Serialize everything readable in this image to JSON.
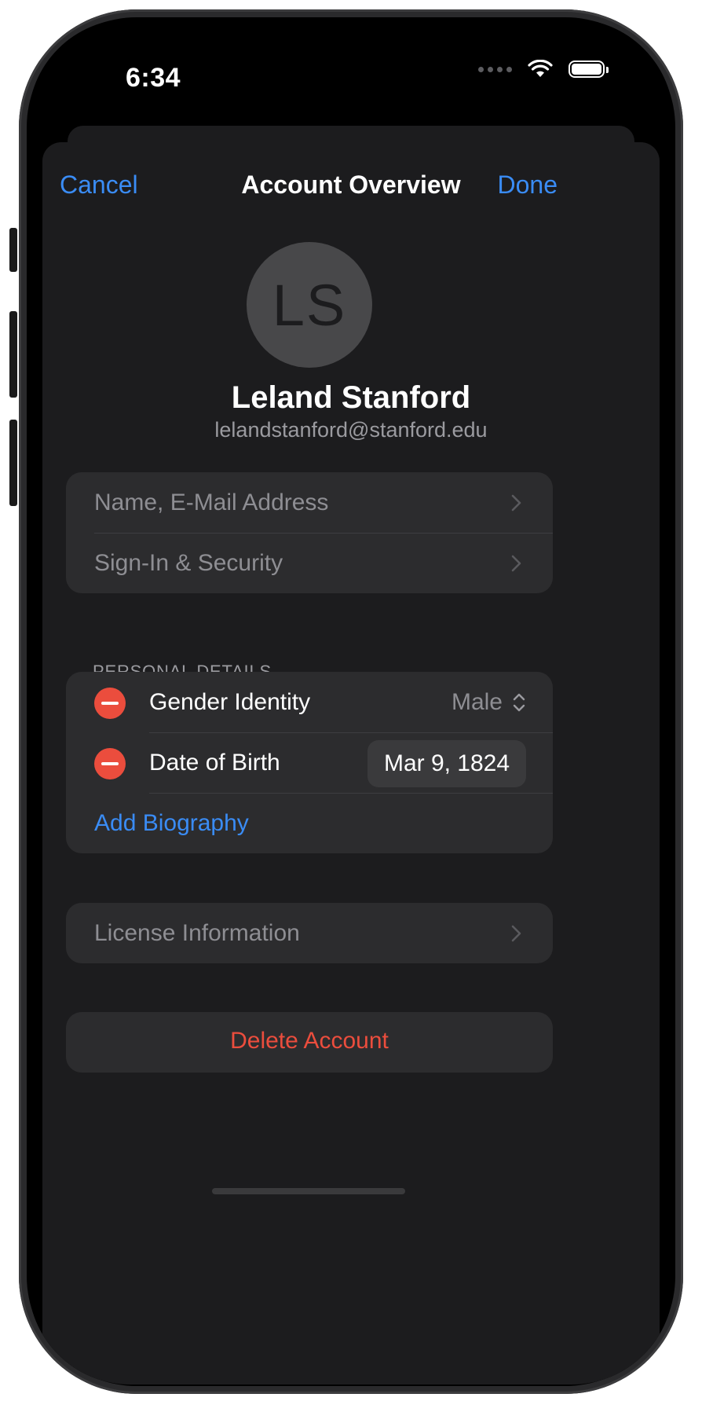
{
  "status": {
    "time": "6:34"
  },
  "nav": {
    "cancel": "Cancel",
    "title": "Account Overview",
    "done": "Done"
  },
  "profile": {
    "initials": "LS",
    "name": "Leland Stanford",
    "email": "lelandstanford@stanford.edu"
  },
  "account_group": {
    "items": [
      {
        "label": "Name, E-Mail Address"
      },
      {
        "label": "Sign-In & Security"
      }
    ]
  },
  "personal_details": {
    "header": "PERSONAL DETAILS",
    "gender": {
      "label": "Gender Identity",
      "value": "Male"
    },
    "dob": {
      "label": "Date of Birth",
      "value": "Mar 9, 1824"
    },
    "add_biography": "Add Biography"
  },
  "license": {
    "label": "License Information"
  },
  "delete": {
    "label": "Delete Account"
  },
  "colors": {
    "accent": "#3a8cf5",
    "destructive": "#eb4d3d",
    "background": "#1c1c1e",
    "cell": "#2c2c2e"
  }
}
